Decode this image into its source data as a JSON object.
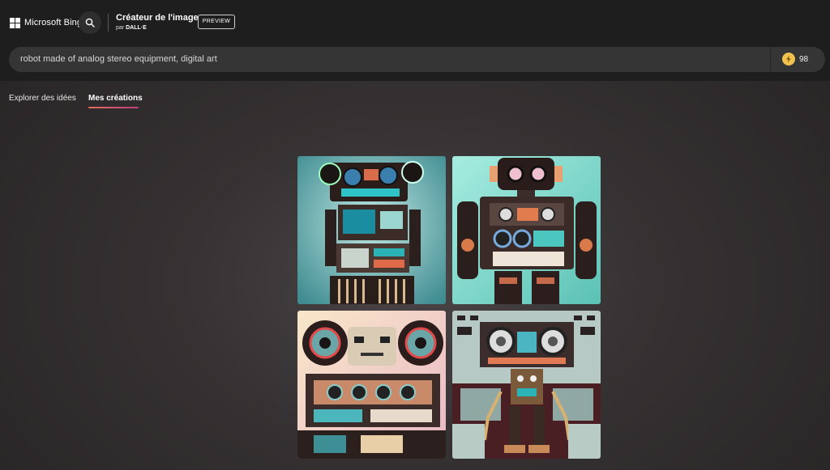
{
  "header": {
    "brand": "Microsoft Bing",
    "title": "Créateur de l'image",
    "subtitle_prefix": "par",
    "subtitle_brand": "DALL·E",
    "badge": "PREVIEW"
  },
  "prompt": {
    "text": "robot made of analog stereo equipment, digital art",
    "boosts": "98"
  },
  "tabs": [
    {
      "label": "Explorer des idées",
      "active": false
    },
    {
      "label": "Mes créations",
      "active": true
    }
  ],
  "icons": {
    "logo": "microsoft-logo-icon",
    "search": "search-icon",
    "boost": "lightning-bolt-icon"
  },
  "colors": {
    "tab_accent_start": "#e2705b",
    "tab_accent_end": "#c33c7d",
    "boost": "#f2c14e"
  }
}
